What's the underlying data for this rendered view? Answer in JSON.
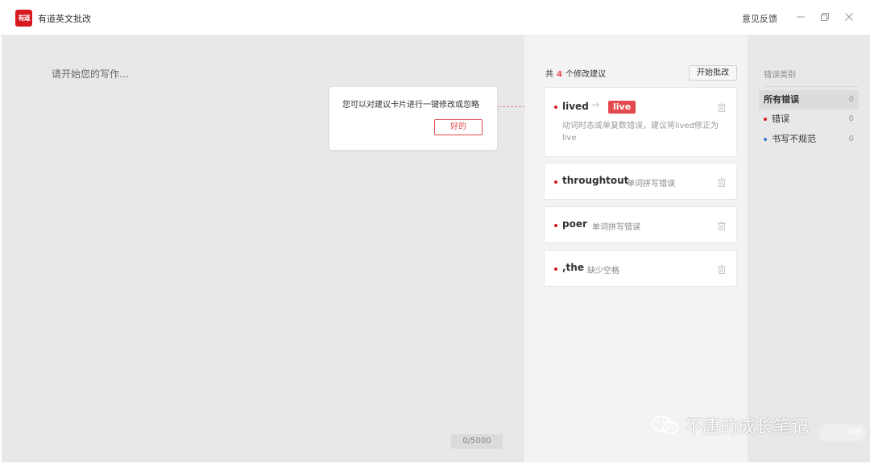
{
  "app": {
    "logo_text": "有道",
    "title": "有道英文批改",
    "feedback": "意见反馈"
  },
  "editor": {
    "placeholder": "请开始您的写作...",
    "word_count": "0/5000"
  },
  "tooltip": {
    "text": "您可以对建议卡片进行一键修改或忽略",
    "ok_label": "好的"
  },
  "suggestions": {
    "prefix": "共",
    "count": "4",
    "suffix": "个修改建议",
    "start_label": "开始批改",
    "cards": [
      {
        "word": "lived",
        "fix": "live",
        "desc": "动词时态或单复数错误，建议将lived修正为live"
      },
      {
        "word": "throughtout",
        "desc": "单词拼写错误"
      },
      {
        "word": "poer",
        "desc": "单词拼写错误"
      },
      {
        "word": ",the",
        "desc": "缺少空格"
      }
    ]
  },
  "categories": {
    "title": "错误类别",
    "items": [
      {
        "label": "所有错误",
        "count": "0"
      },
      {
        "label": "错误",
        "count": "0",
        "color": "#d71920"
      },
      {
        "label": "书写不规范",
        "count": "0",
        "color": "#3a7bd5"
      }
    ]
  },
  "watermark": {
    "text": "不唐的成长笔记",
    "tag": "对图"
  },
  "colors": {
    "brand": "#d71920",
    "accent": "#e34a4f"
  }
}
